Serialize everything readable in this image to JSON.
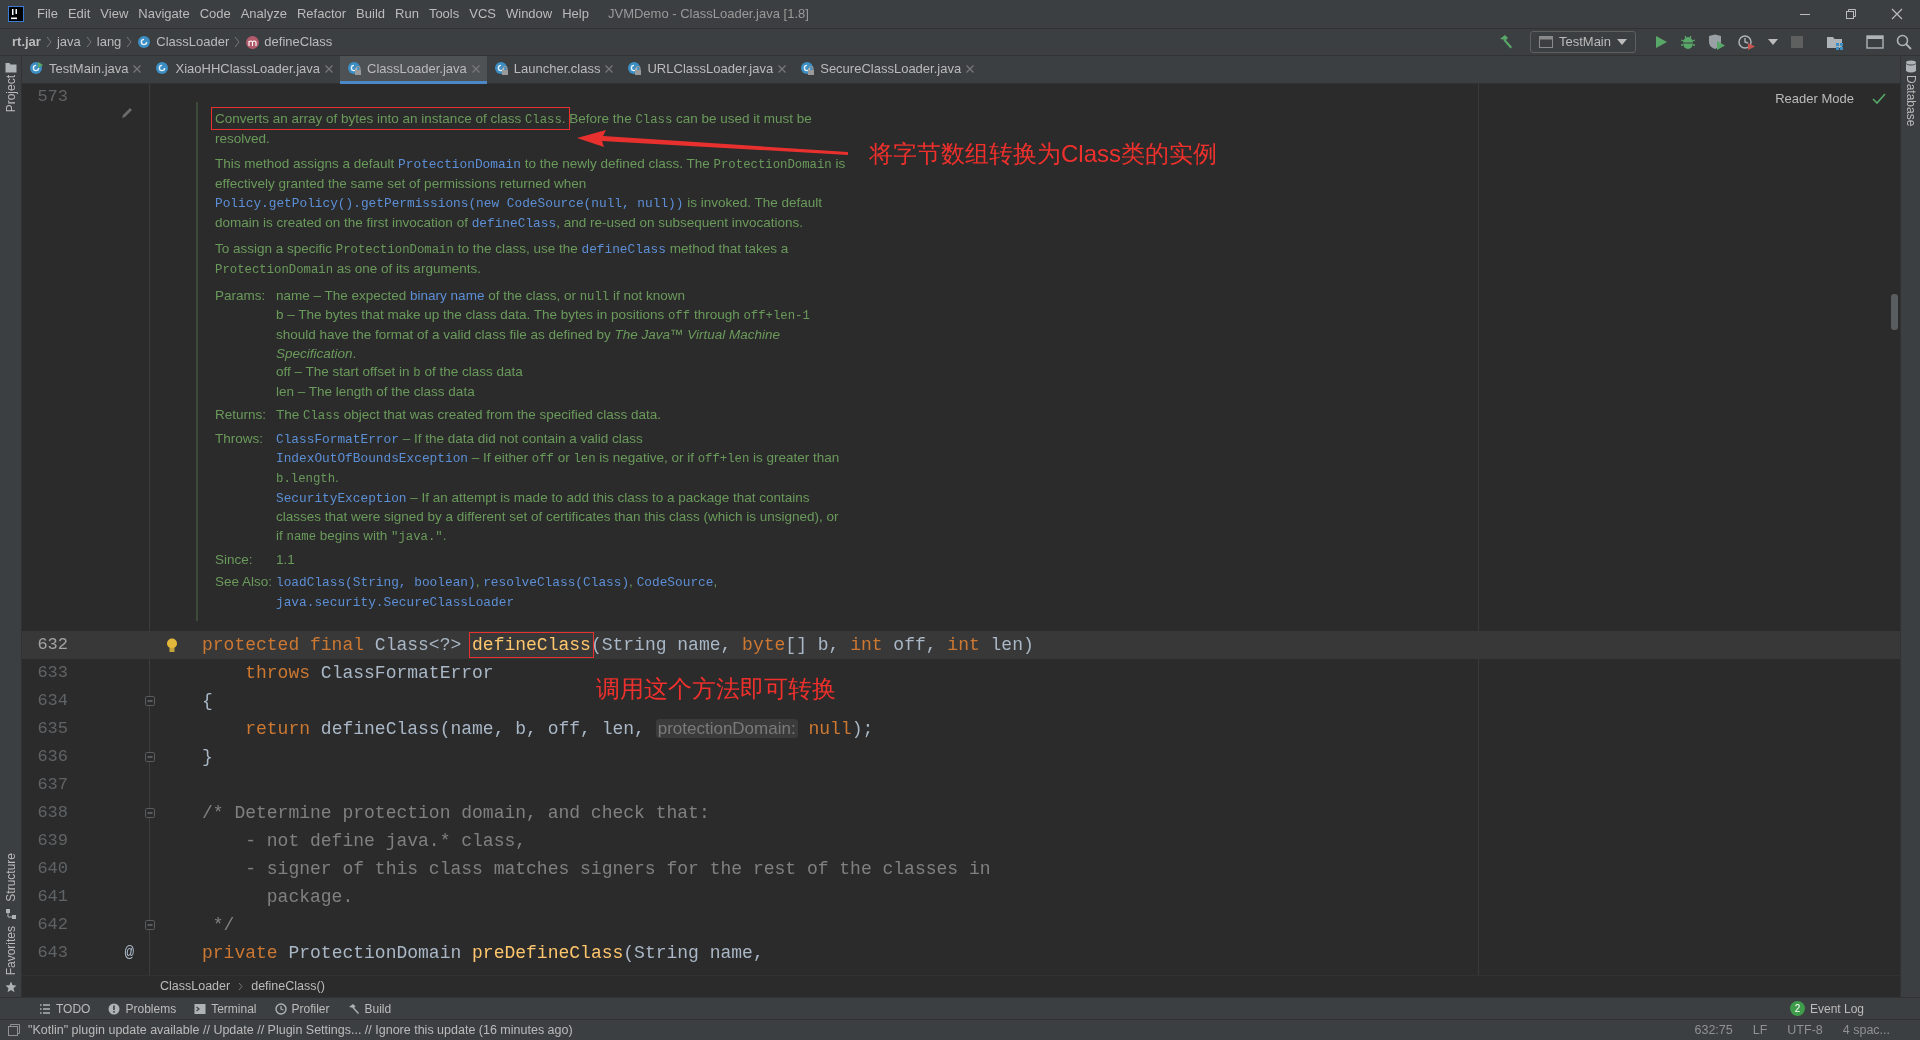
{
  "menu_bar": {
    "items": [
      "File",
      "Edit",
      "View",
      "Navigate",
      "Code",
      "Analyze",
      "Refactor",
      "Build",
      "Run",
      "Tools",
      "VCS",
      "Window",
      "Help"
    ],
    "title": "JVMDemo - ClassLoader.java [1.8]"
  },
  "nav_bar": {
    "breadcrumb": [
      {
        "text": "rt.jar",
        "kind": "jar"
      },
      {
        "text": "java",
        "kind": "package"
      },
      {
        "text": "lang",
        "kind": "package"
      },
      {
        "text": "ClassLoader",
        "kind": "class"
      },
      {
        "text": "defineClass",
        "kind": "method"
      }
    ],
    "run_config": "TestMain"
  },
  "left_strip": [
    "Project",
    "Structure",
    "Favorites"
  ],
  "right_strip": [
    "Database"
  ],
  "tabs": [
    {
      "label": "TestMain.java",
      "kind": "runnable",
      "locked": false,
      "selected": false
    },
    {
      "label": "XiaoHHClassLoader.java",
      "kind": "class",
      "locked": false,
      "selected": false
    },
    {
      "label": "ClassLoader.java",
      "kind": "class",
      "locked": true,
      "selected": true
    },
    {
      "label": "Launcher.class",
      "kind": "class",
      "locked": true,
      "selected": false
    },
    {
      "label": "URLClassLoader.java",
      "kind": "class",
      "locked": true,
      "selected": false
    },
    {
      "label": "SecureClassLoader.java",
      "kind": "class",
      "locked": true,
      "selected": false
    }
  ],
  "reader_mode": "Reader Mode",
  "doc": {
    "line_number": "573",
    "paragraphs": [
      [
        {
          "kind": "frame",
          "parts": [
            {
              "kind": "text",
              "text": "Converts an array of bytes into an instance of class "
            },
            {
              "kind": "code",
              "text": "Class"
            },
            {
              "kind": "text",
              "text": "."
            }
          ]
        },
        {
          "kind": "text",
          "text": " Before the "
        },
        {
          "kind": "code",
          "text": "Class"
        },
        {
          "kind": "text",
          "text": " can be used it must be resolved."
        }
      ],
      [
        {
          "kind": "text",
          "text": "This method assigns a default "
        },
        {
          "kind": "link",
          "text": "ProtectionDomain"
        },
        {
          "kind": "text",
          "text": " to the newly defined class. The "
        },
        {
          "kind": "code",
          "text": "ProtectionDomain"
        },
        {
          "kind": "text",
          "text": " is effectively granted the same set of permissions returned when "
        },
        {
          "kind": "link",
          "text": "Policy.getPolicy().getPermissions(new CodeSource(null, null))"
        },
        {
          "kind": "text",
          "text": " is invoked. The default domain is created on the first invocation of "
        },
        {
          "kind": "link",
          "text": "defineClass"
        },
        {
          "kind": "text",
          "text": ", and re-used on subsequent invocations."
        }
      ],
      [
        {
          "kind": "text",
          "text": "To assign a specific "
        },
        {
          "kind": "code",
          "text": "ProtectionDomain"
        },
        {
          "kind": "text",
          "text": " to the class, use the "
        },
        {
          "kind": "link",
          "text": "defineClass"
        },
        {
          "kind": "text",
          "text": " method that takes a "
        },
        {
          "kind": "code",
          "text": "ProtectionDomain"
        },
        {
          "kind": "text",
          "text": " as one of its arguments."
        }
      ]
    ],
    "tags": [
      {
        "label": "Params:",
        "entries": [
          [
            {
              "kind": "text",
              "text": "name – The expected "
            },
            {
              "kind": "wordlink",
              "text": "binary name"
            },
            {
              "kind": "text",
              "text": " of the class, or "
            },
            {
              "kind": "code",
              "text": "null"
            },
            {
              "kind": "text",
              "text": " if not known"
            }
          ],
          [
            {
              "kind": "text",
              "text": "b – The bytes that make up the class data. The bytes in positions "
            },
            {
              "kind": "code",
              "text": "off"
            },
            {
              "kind": "text",
              "text": " through "
            },
            {
              "kind": "code",
              "text": "off+len-1"
            },
            {
              "kind": "text",
              "text": " should have the format of a valid class file as defined by "
            },
            {
              "kind": "italic",
              "text": "The Java™ Virtual Machine Specification"
            },
            {
              "kind": "text",
              "text": "."
            }
          ],
          [
            {
              "kind": "text",
              "text": "off – The start offset in "
            },
            {
              "kind": "code",
              "text": "b"
            },
            {
              "kind": "text",
              "text": " of the class data"
            }
          ],
          [
            {
              "kind": "text",
              "text": "len – The length of the class data"
            }
          ]
        ]
      },
      {
        "label": "Returns:",
        "entries": [
          [
            {
              "kind": "text",
              "text": "The "
            },
            {
              "kind": "code",
              "text": "Class"
            },
            {
              "kind": "text",
              "text": " object that was created from the specified class data."
            }
          ]
        ]
      },
      {
        "label": "Throws:",
        "entries": [
          [
            {
              "kind": "link",
              "text": "ClassFormatError"
            },
            {
              "kind": "text",
              "text": " – If the data did not contain a valid class"
            }
          ],
          [
            {
              "kind": "link",
              "text": "IndexOutOfBoundsException"
            },
            {
              "kind": "text",
              "text": " – If either "
            },
            {
              "kind": "code",
              "text": "off"
            },
            {
              "kind": "text",
              "text": " or "
            },
            {
              "kind": "code",
              "text": "len"
            },
            {
              "kind": "text",
              "text": " is negative, or if "
            },
            {
              "kind": "code",
              "text": "off+len"
            },
            {
              "kind": "text",
              "text": " is greater than "
            },
            {
              "kind": "code",
              "text": "b.length"
            },
            {
              "kind": "text",
              "text": "."
            }
          ],
          [
            {
              "kind": "link",
              "text": "SecurityException"
            },
            {
              "kind": "text",
              "text": " – If an attempt is made to add this class to a package that contains classes that were signed by a different set of certificates than this class (which is unsigned), or if "
            },
            {
              "kind": "code",
              "text": "name"
            },
            {
              "kind": "text",
              "text": " begins with "
            },
            {
              "kind": "code",
              "text": "\"java.\""
            },
            {
              "kind": "text",
              "text": "."
            }
          ]
        ]
      },
      {
        "label": "Since:",
        "entries": [
          [
            {
              "kind": "text",
              "text": "1.1"
            }
          ]
        ]
      },
      {
        "label": "See Also:",
        "entries": [
          [
            {
              "kind": "link",
              "text": "loadClass(String, boolean)"
            },
            {
              "kind": "text",
              "text": ", "
            },
            {
              "kind": "link",
              "text": "resolveClass(Class)"
            },
            {
              "kind": "text",
              "text": ", "
            },
            {
              "kind": "link",
              "text": "CodeSource"
            },
            {
              "kind": "text",
              "text": ", "
            },
            {
              "kind": "link",
              "text": "java.security.SecureClassLoader"
            }
          ]
        ]
      }
    ]
  },
  "code_lines": [
    {
      "number": "632",
      "current": true,
      "bulb": true,
      "fold": false,
      "tokens": [
        {
          "kind": "keyword",
          "text": "protected final "
        },
        {
          "kind": "plain",
          "text": "Class<?> "
        },
        {
          "kind": "frame",
          "parts": [
            {
              "kind": "method",
              "text": "defineClass"
            }
          ]
        },
        {
          "kind": "plain",
          "text": "(String name, "
        },
        {
          "kind": "keyword",
          "text": "byte"
        },
        {
          "kind": "plain",
          "text": "[] b, "
        },
        {
          "kind": "keyword",
          "text": "int"
        },
        {
          "kind": "plain",
          "text": " off, "
        },
        {
          "kind": "keyword",
          "text": "int"
        },
        {
          "kind": "plain",
          "text": " len)"
        }
      ]
    },
    {
      "number": "633",
      "current": false,
      "bulb": false,
      "fold": false,
      "tokens": [
        {
          "kind": "keyword",
          "text": "    throws"
        },
        {
          "kind": "plain",
          "text": " ClassFormatError"
        }
      ]
    },
    {
      "number": "634",
      "current": false,
      "bulb": false,
      "fold": true,
      "tokens": [
        {
          "kind": "plain",
          "text": "{"
        }
      ]
    },
    {
      "number": "635",
      "current": false,
      "bulb": false,
      "fold": false,
      "tokens": [
        {
          "kind": "keyword",
          "text": "    return"
        },
        {
          "kind": "plain",
          "text": " defineClass(name, b, off, len, "
        },
        {
          "kind": "hint",
          "text": "protectionDomain:"
        },
        {
          "kind": "keyword",
          "text": " null"
        },
        {
          "kind": "plain",
          "text": ");"
        }
      ]
    },
    {
      "number": "636",
      "current": false,
      "bulb": false,
      "fold": true,
      "tokens": [
        {
          "kind": "plain",
          "text": "}"
        }
      ]
    },
    {
      "number": "637",
      "current": false,
      "bulb": false,
      "fold": false
    },
    {
      "number": "638",
      "current": false,
      "bulb": false,
      "fold": true,
      "tokens": [
        {
          "kind": "comment",
          "text": "/* Determine protection domain, and check that:"
        }
      ]
    },
    {
      "number": "639",
      "current": false,
      "bulb": false,
      "fold": false,
      "tokens": [
        {
          "kind": "comment",
          "text": "    - not define java.* class,"
        }
      ]
    },
    {
      "number": "640",
      "current": false,
      "bulb": false,
      "fold": false,
      "tokens": [
        {
          "kind": "comment",
          "text": "    - signer of this class matches signers for the rest of the classes in"
        }
      ]
    },
    {
      "number": "641",
      "current": false,
      "bulb": false,
      "fold": false,
      "tokens": [
        {
          "kind": "comment",
          "text": "      package."
        }
      ]
    },
    {
      "number": "642",
      "current": false,
      "bulb": false,
      "fold": true,
      "tokens": [
        {
          "kind": "comment",
          "text": " */"
        }
      ]
    },
    {
      "number": "643",
      "current": false,
      "bulb": false,
      "fold": false,
      "gutter_text": "@",
      "tokens": [
        {
          "kind": "keyword",
          "text": "private"
        },
        {
          "kind": "plain",
          "text": " ProtectionDomain "
        },
        {
          "kind": "method",
          "text": "preDefineClass"
        },
        {
          "kind": "plain",
          "text": "(String name,"
        }
      ]
    }
  ],
  "annotations": [
    {
      "kind": "doc",
      "text": "将字节数组转换为Class类的实例"
    },
    {
      "kind": "code",
      "text": "调用这个方法即可转换"
    }
  ],
  "footer_breadcrumb": [
    "ClassLoader",
    "defineClass()"
  ],
  "tool_windows": [
    {
      "label": "TODO",
      "kind": "todo"
    },
    {
      "label": "Problems",
      "kind": "problems"
    },
    {
      "label": "Terminal",
      "kind": "terminal"
    },
    {
      "label": "Profiler",
      "kind": "profiler"
    },
    {
      "label": "Build",
      "kind": "build"
    }
  ],
  "event_log": {
    "count": "2",
    "label": "Event Log"
  },
  "status_bar": {
    "message": "\"Kotlin\" plugin update available // Update // Plugin Settings... // Ignore this update (16 minutes ago)",
    "items": [
      "632:75",
      "LF",
      "UTF-8",
      "4 spac..."
    ]
  }
}
